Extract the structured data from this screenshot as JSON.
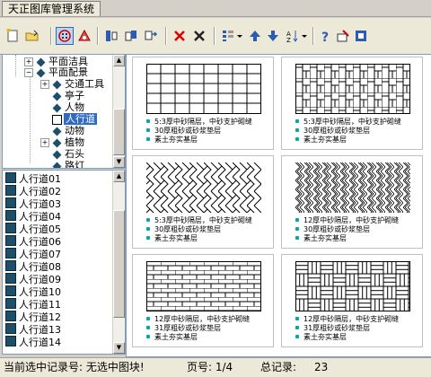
{
  "window": {
    "title": "天正图库管理系统"
  },
  "toolbar": {
    "icons": [
      "new-icon",
      "open-icon",
      "grid-view-icon",
      "library-icon",
      "export-icon",
      "import-icon",
      "replace-icon",
      "delete-icon",
      "close-icon",
      "view-icon",
      "up-icon",
      "down-icon",
      "sort-icon",
      "help-icon",
      "settings-icon",
      "tool-icon"
    ]
  },
  "tree": {
    "items": [
      {
        "label": "平面洁具"
      },
      {
        "label": "平面配景"
      },
      {
        "label": "交通工具"
      },
      {
        "label": "亭子"
      },
      {
        "label": "人物"
      },
      {
        "label": "人行道"
      },
      {
        "label": "动物"
      },
      {
        "label": "植物"
      },
      {
        "label": "石头"
      },
      {
        "label": "路灯"
      }
    ]
  },
  "list": {
    "items": [
      "人行道01",
      "人行道02",
      "人行道03",
      "人行道04",
      "人行道05",
      "人行道06",
      "人行道07",
      "人行道08",
      "人行道09",
      "人行道10",
      "人行道11",
      "人行道12",
      "人行道13",
      "人行道14"
    ]
  },
  "cells": [
    {
      "lines": [
        "5:3厚中砂隔层，中砂支护砌缝",
        "30厚粗砂或砂浆垫层",
        "素土夯实基层"
      ]
    },
    {
      "lines": [
        "5:3厚中砂隔层，中砂支护砌缝",
        "30厚粗砂或砂浆垫层",
        "素土夯实基层"
      ]
    },
    {
      "lines": [
        "5:3厚中砂隔层，中砂支护砌缝",
        "30厚粗砂或砂浆垫层",
        "素土夯实基层"
      ]
    },
    {
      "lines": [
        "12厚中砂隔层，中砂支护砌缝",
        "30厚粗砂或砂浆垫层",
        "素土夯实基层"
      ]
    },
    {
      "lines": [
        "12厚中砂隔层，中砂支护砌缝",
        "31厚粗砂或砂浆垫层",
        "素土夯实基层"
      ]
    },
    {
      "lines": [
        "12厚中砂隔层，中砂支护砌缝",
        "31厚粗砂或砂浆垫层",
        "素土夯实基层"
      ]
    }
  ],
  "status": {
    "record_label": "当前选中记录号: 无选中图块!",
    "page_label": "页号: 1/4",
    "total_label": "总记录:",
    "total_value": "23"
  }
}
